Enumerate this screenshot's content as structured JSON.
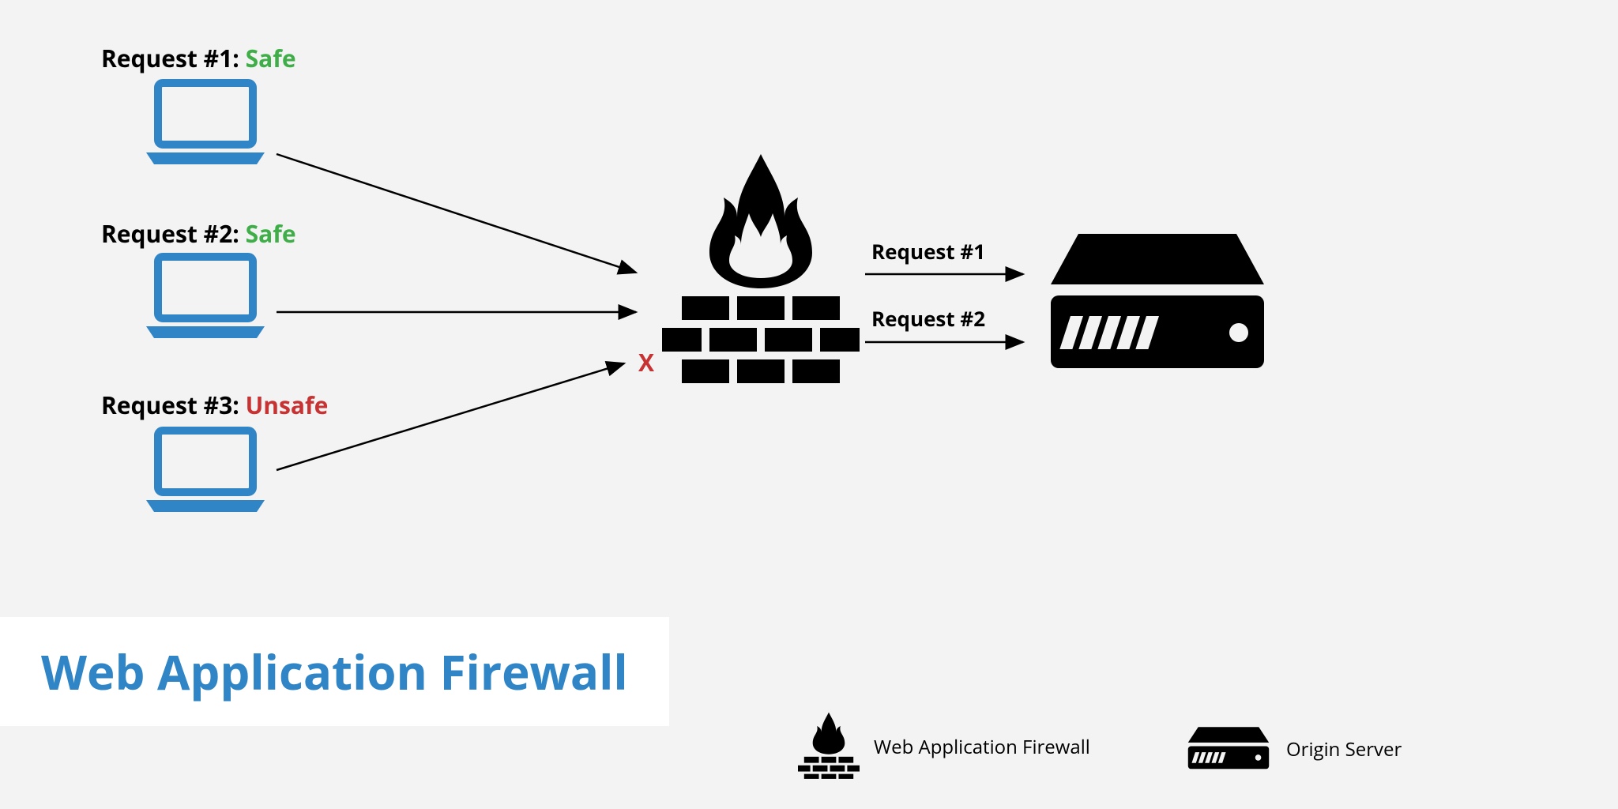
{
  "requests": [
    {
      "prefix": "Request #1: ",
      "status": "Safe",
      "status_class": "safe"
    },
    {
      "prefix": "Request #2: ",
      "status": "Safe",
      "status_class": "safe"
    },
    {
      "prefix": "Request #3: ",
      "status": "Unsafe",
      "status_class": "unsafe"
    }
  ],
  "blocked_mark": "X",
  "passed": [
    {
      "label": "Request #1"
    },
    {
      "label": "Request #2"
    }
  ],
  "title": "Web Application Firewall",
  "legend": {
    "firewall": "Web Application Firewall",
    "server": "Origin Server"
  },
  "colors": {
    "laptop": "#2f85c6",
    "safe": "#3fae49",
    "unsafe": "#c73232",
    "title": "#2f85c6",
    "icon": "#000000"
  }
}
